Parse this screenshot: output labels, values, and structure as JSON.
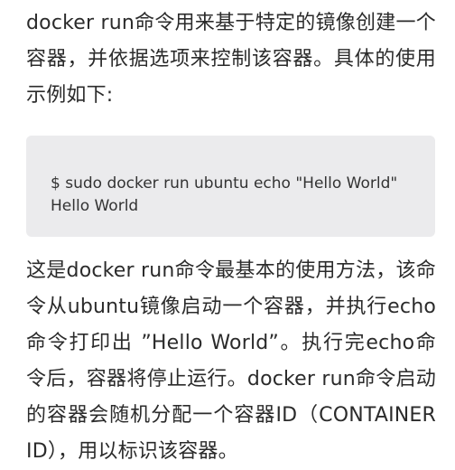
{
  "article": {
    "intro": "docker run命令用来基于特定的镜像创建一个容器，并依据选项来控制该容器。具体的使用示例如下:",
    "code": {
      "command": "$ sudo docker run ubuntu echo \"Hello World\"",
      "output": "Hello World"
    },
    "explanation": "这是docker run命令最基本的使用方法，该命令从ubuntu镜像启动一个容器，并执行echo命令打印出 ”Hello World”。执行完echo命令后，容器将停止运行。docker run命令启动的容器会随机分配一个容器ID（CONTAINER ID），用以标识该容器。"
  }
}
